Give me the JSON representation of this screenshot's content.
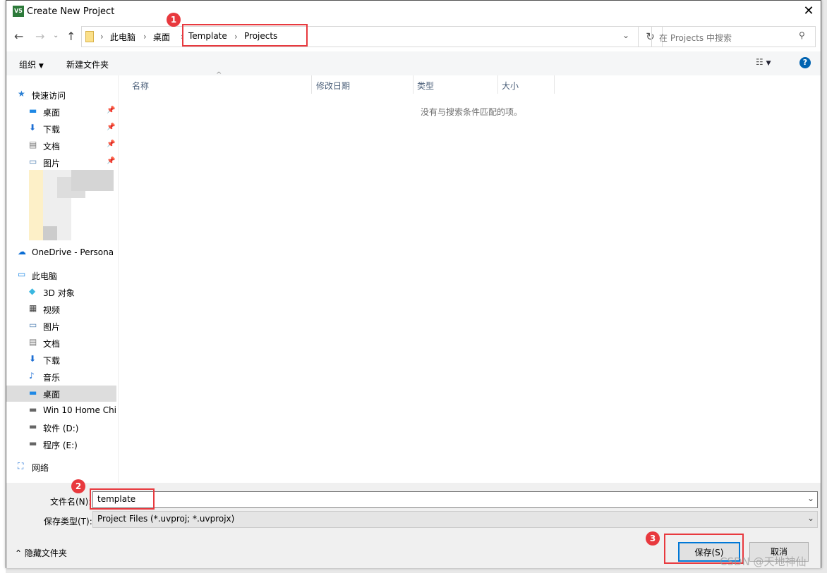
{
  "window": {
    "title": "Create New Project",
    "app_icon": "keil-uvision-icon"
  },
  "nav": {
    "breadcrumb": [
      "此电脑",
      "桌面",
      "Template",
      "Projects"
    ],
    "search_placeholder": "在 Projects 中搜索"
  },
  "toolbar": {
    "organize": "组织",
    "new_folder": "新建文件夹"
  },
  "sidebar": {
    "items": [
      {
        "label": "快速访问",
        "icon": "star-icon",
        "level": 0
      },
      {
        "label": "桌面",
        "icon": "desktop-icon",
        "level": 1,
        "pinned": true
      },
      {
        "label": "下载",
        "icon": "download-icon",
        "level": 1,
        "pinned": true
      },
      {
        "label": "文档",
        "icon": "document-icon",
        "level": 1,
        "pinned": true
      },
      {
        "label": "图片",
        "icon": "picture-icon",
        "level": 1,
        "pinned": true
      },
      {
        "label": "OneDrive - Persona",
        "icon": "cloud-icon",
        "level": 0
      },
      {
        "label": "此电脑",
        "icon": "computer-icon",
        "level": 0
      },
      {
        "label": "3D 对象",
        "icon": "cube-icon",
        "level": 1
      },
      {
        "label": "视频",
        "icon": "video-icon",
        "level": 1
      },
      {
        "label": "图片",
        "icon": "picture-icon",
        "level": 1
      },
      {
        "label": "文档",
        "icon": "document-icon",
        "level": 1
      },
      {
        "label": "下载",
        "icon": "download-icon",
        "level": 1
      },
      {
        "label": "音乐",
        "icon": "music-icon",
        "level": 1
      },
      {
        "label": "桌面",
        "icon": "desktop-icon",
        "level": 1,
        "selected": true
      },
      {
        "label": "Win 10 Home Chi",
        "icon": "drive-icon",
        "level": 1
      },
      {
        "label": "软件 (D:)",
        "icon": "drive-icon",
        "level": 1
      },
      {
        "label": "程序 (E:)",
        "icon": "drive-icon",
        "level": 1
      },
      {
        "label": "网络",
        "icon": "network-icon",
        "level": 0
      }
    ]
  },
  "columns": [
    "名称",
    "修改日期",
    "类型",
    "大小"
  ],
  "empty_message": "没有与搜索条件匹配的项。",
  "form": {
    "filename_label": "文件名(N):",
    "filename_value": "template",
    "filetype_label": "保存类型(T):",
    "filetype_value": "Project Files (*.uvproj; *.uvprojx)"
  },
  "footer": {
    "hide_folders": "隐藏文件夹",
    "save": "保存(S)",
    "cancel": "取消"
  },
  "annotations": [
    "1",
    "2",
    "3"
  ],
  "watermark": "CSDN @天地神仙",
  "colors": {
    "annotation": "#e8393e",
    "focus": "#0078d7",
    "help": "#0063b1"
  }
}
